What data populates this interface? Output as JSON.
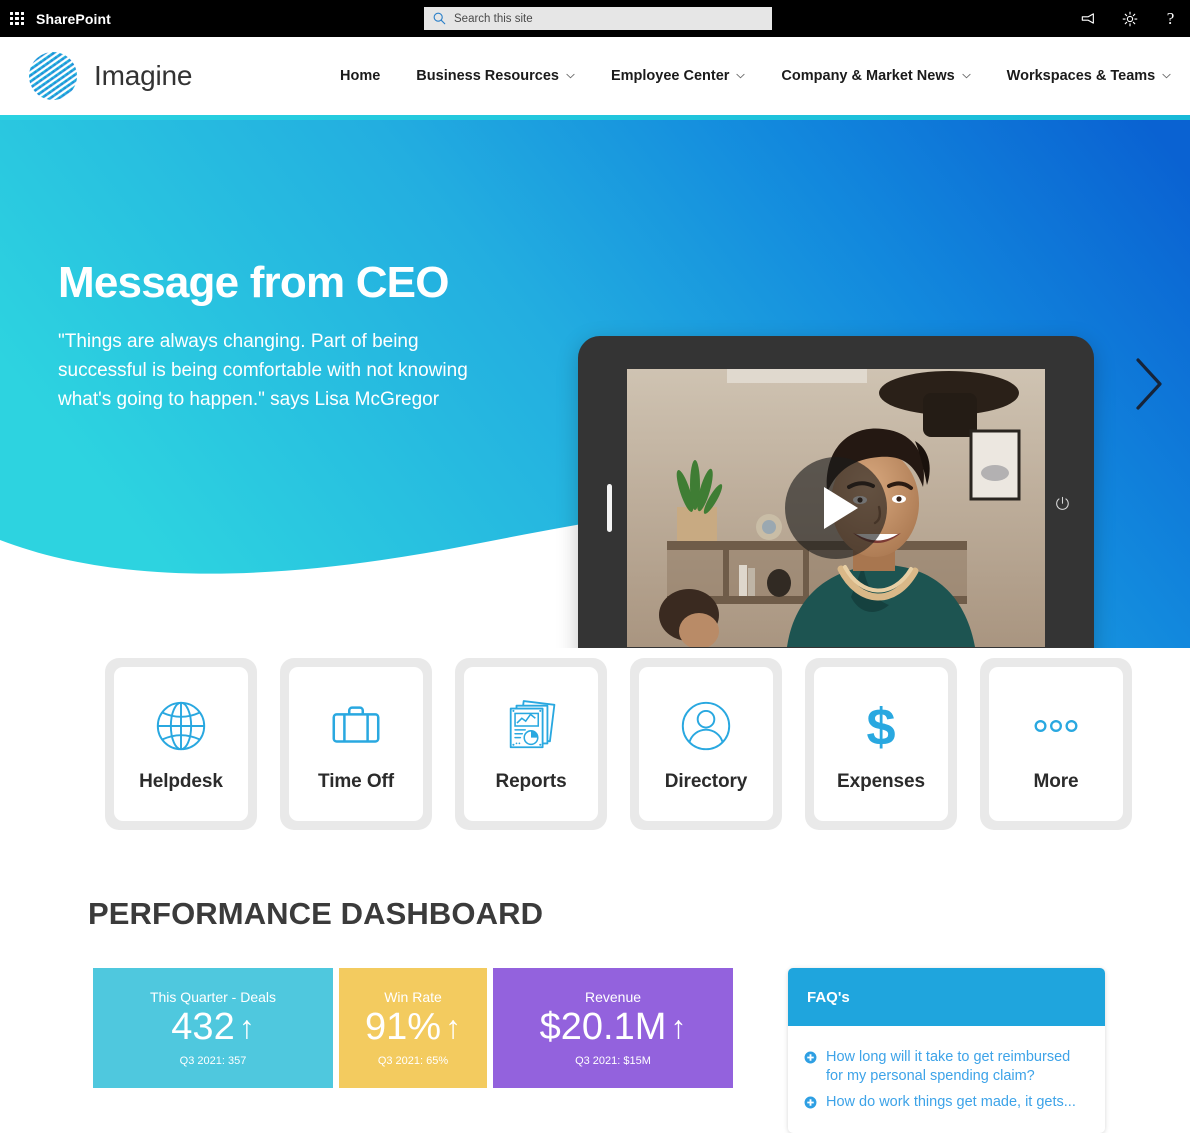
{
  "suite_bar": {
    "waffle_icon": "app-launcher-waffle-icon",
    "brand": "SharePoint",
    "search_placeholder": "Search this site",
    "search_value": "",
    "search_icon": "search-icon",
    "feedback_icon": "megaphone-icon",
    "settings_icon": "gear-icon",
    "help_icon": "question-mark-icon",
    "help_glyph": "?",
    "background": "#000000"
  },
  "site_header": {
    "logo_icon": "imagine-striped-circle-logo",
    "title": "Imagine",
    "nav": [
      {
        "label": "Home",
        "has_caret": false
      },
      {
        "label": "Business Resources",
        "has_caret": true
      },
      {
        "label": "Employee Center",
        "has_caret": true
      },
      {
        "label": "Company & Market News",
        "has_caret": true
      },
      {
        "label": "Workspaces & Teams",
        "has_caret": true
      }
    ],
    "accent_color": "#2ad2e2"
  },
  "hero": {
    "title": "Message from CEO",
    "quote": "\"Things are always changing. Part of being successful is being comfortable with not knowing what's going to happen.\" says Lisa McGregor",
    "gradient_from": "#2dd3e0",
    "gradient_to": "#0a6fd6",
    "play_icon": "play-button-icon",
    "next_icon": "chevron-right-icon",
    "device_icon": "tablet-device-mockup",
    "power_icon": "power-button-icon"
  },
  "tiles": [
    {
      "label": "Helpdesk",
      "icon": "globe-icon"
    },
    {
      "label": "Time Off",
      "icon": "briefcase-icon"
    },
    {
      "label": "Reports",
      "icon": "reports-documents-icon"
    },
    {
      "label": "Directory",
      "icon": "person-circle-icon"
    },
    {
      "label": "Expenses",
      "icon": "dollar-sign-icon"
    },
    {
      "label": "More",
      "icon": "ellipsis-icon"
    }
  ],
  "dashboard": {
    "heading": "PERFORMANCE DASHBOARD",
    "kpis": [
      {
        "label": "This Quarter - Deals",
        "value": "432",
        "arrow": "↑",
        "sub": "Q3 2021: 357",
        "color": "#4fc8de"
      },
      {
        "label": "Win Rate",
        "value": "91%",
        "arrow": "↑",
        "sub": "Q3 2021: 65%",
        "color": "#f3cb5f"
      },
      {
        "label": "Revenue",
        "value": "$20.1M",
        "arrow": "↑",
        "sub": "Q3 2021: $15M",
        "color": "#9362dd"
      }
    ]
  },
  "faq": {
    "title": "FAQ's",
    "header_color": "#1fa5dd",
    "plus_icon": "plus-circle-icon",
    "items": [
      {
        "question": "How long will it take to get reimbursed for my personal spending claim?"
      },
      {
        "question": "How do work things get made, it gets..."
      }
    ]
  },
  "chart_data": {
    "type": "bar",
    "title": "PERFORMANCE DASHBOARD",
    "categories": [
      "This Quarter - Deals",
      "Win Rate",
      "Revenue"
    ],
    "values": [
      432,
      91,
      20.1
    ],
    "previous_values": [
      357,
      65,
      15
    ],
    "value_labels": [
      "432",
      "91%",
      "$20.1M"
    ],
    "previous_labels": [
      "Q3 2021: 357",
      "Q3 2021: 65%",
      "Q3 2021: $15M"
    ],
    "trends": [
      "up",
      "up",
      "up"
    ],
    "colors": [
      "#4fc8de",
      "#f3cb5f",
      "#9362dd"
    ],
    "xlabel": "",
    "ylabel": "",
    "legend": false,
    "grid": false
  }
}
